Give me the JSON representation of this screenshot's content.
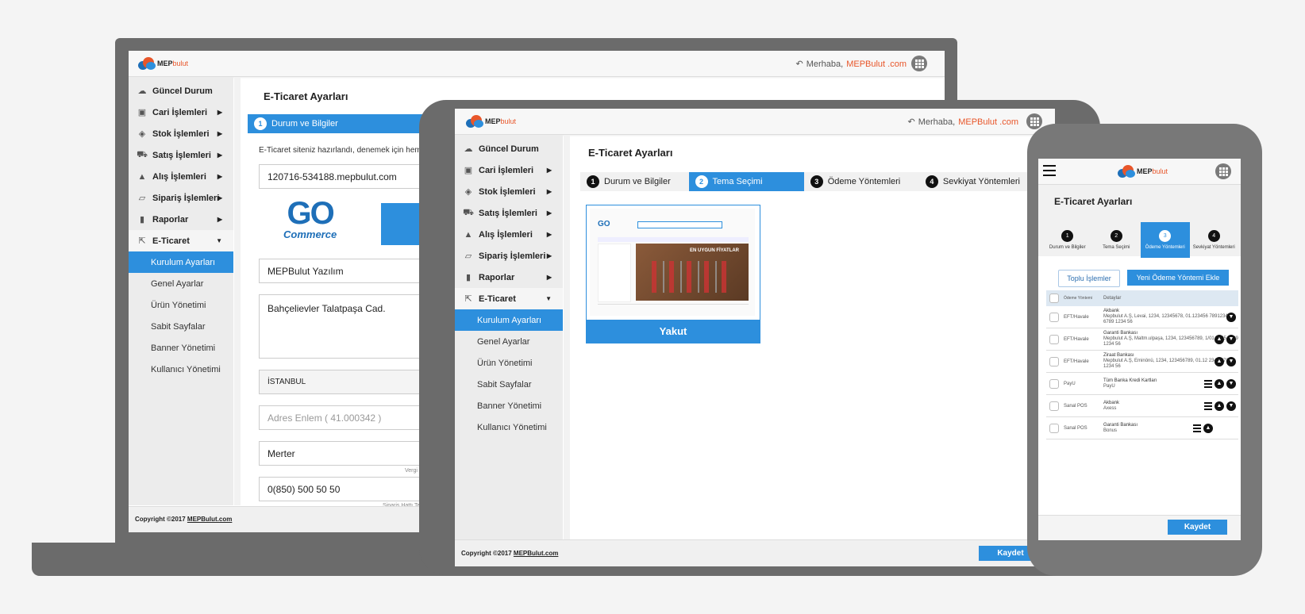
{
  "brand": {
    "logo_main": "MEP",
    "logo_accent": "bulut",
    "greeting": "Merhaba,",
    "user": "MEPBulut .com"
  },
  "menu": {
    "items": [
      {
        "label": "Güncel Durum",
        "icon": "dashboard-icon"
      },
      {
        "label": "Cari İşlemleri",
        "icon": "contacts-icon"
      },
      {
        "label": "Stok İşlemleri",
        "icon": "box-icon"
      },
      {
        "label": "Satış İşlemleri",
        "icon": "cart-icon"
      },
      {
        "label": "Alış İşlemleri",
        "icon": "bag-icon"
      },
      {
        "label": "Sipariş İşlemleri",
        "icon": "order-icon"
      },
      {
        "label": "Raporlar",
        "icon": "bar-chart-icon"
      },
      {
        "label": "E-Ticaret",
        "icon": "pointer-icon"
      }
    ],
    "sub": [
      "Kurulum Ayarları",
      "Genel Ayarlar",
      "Ürün Yönetimi",
      "Sabit Sayfalar",
      "Banner Yönetimi",
      "Kullanıcı Yönetimi"
    ]
  },
  "page_title": "E-Ticaret Ayarları",
  "steps": [
    {
      "num": "1",
      "label": "Durum ve Bilgiler"
    },
    {
      "num": "2",
      "label": "Tema Seçimi"
    },
    {
      "num": "3",
      "label": "Ödeme Yöntemleri"
    },
    {
      "num": "4",
      "label": "Sevkiyat Yöntemleri"
    }
  ],
  "laptop": {
    "intro": "E-Ticaret siteniz hazırlandı, denemek için hem",
    "domain": "120716-534188.mepbulut.com",
    "go_logo_top": "GO",
    "go_logo_bottom": "Commerce",
    "company": "MEPBulut Yazılım",
    "address": "Bahçelievler Talatpaşa Cad.",
    "city": "İSTANBUL",
    "lat_placeholder": "Adres Enlem ( 41.000342 )",
    "district": "Merter",
    "district_hint": "Vergi D",
    "phone": "0(850) 500 50 50",
    "phone_hint": "Sipariş Hattı Te"
  },
  "tablet": {
    "theme_name": "Yakut",
    "theme_banner": "EN UYGUN FİYATLAR"
  },
  "footer": {
    "prefix": "Copyright ©2017 ",
    "link": "MEPBulut.com"
  },
  "save_label": "Kaydet",
  "phone": {
    "step_labels": [
      "Durum ve Bilgiler",
      "Tema Seçimi",
      "Ödeme Yöntemleri",
      "Sevkiyat Yöntemleri"
    ],
    "bulk_label": "Toplu İşlemler",
    "add_label": "Yeni Ödeme Yöntemi Ekle",
    "table_headers": [
      "Ödeme Yöntemi",
      "Detaylar"
    ],
    "rows": [
      {
        "type": "EFT/Havale",
        "title": "Akbank",
        "detail": "Mepbulut A.Ş, Levai, 1234, 12345678, 01.123456 78912345 6789 1234 56"
      },
      {
        "type": "EFT/Havale",
        "title": "Garanti Bankası",
        "detail": "Mepbulut A.Ş, Maltm.ulpaşa, 1234, 123456789, 1/01 2345 6789 1234 56"
      },
      {
        "type": "EFT/Havale",
        "title": "Ziraat Bankası",
        "detail": "Mepbulut A.Ş, Eminönü, 1234, 123456789, 01.12 2345 6789 1234 56"
      },
      {
        "type": "PayU",
        "title": "Tüm Banka Kredi Kartları",
        "detail": "PayU"
      },
      {
        "type": "Sanal POS",
        "title": "Akbank",
        "detail": "Axess"
      },
      {
        "type": "Sanal POS",
        "title": "Garanti Bankası",
        "detail": "Bonus"
      }
    ]
  }
}
